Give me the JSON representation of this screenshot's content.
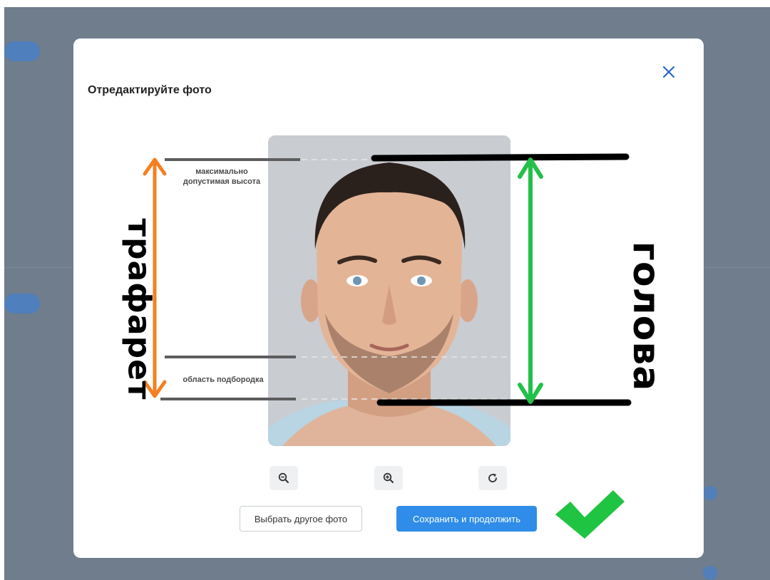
{
  "dialog": {
    "title": "Отредактируйте фото",
    "close_icon": "close-icon"
  },
  "photo": {
    "hint_max_height": "максимально допустимая высота",
    "hint_chin_area": "область подбородка"
  },
  "annotations": {
    "stencil_label": "трафарет",
    "head_label": "голова",
    "stencil_arrow_color": "#f47f20",
    "head_arrow_color": "#22c04a",
    "checkmark_color": "#1fc442"
  },
  "tools": [
    {
      "name": "zoom-out-icon"
    },
    {
      "name": "zoom-in-icon"
    },
    {
      "name": "rotate-icon"
    }
  ],
  "actions": {
    "choose_other": "Выбрать другое фото",
    "save_continue": "Сохранить и продолжить"
  },
  "colors": {
    "primary": "#2f8ce8",
    "backdrop": "#6f7d8c"
  }
}
